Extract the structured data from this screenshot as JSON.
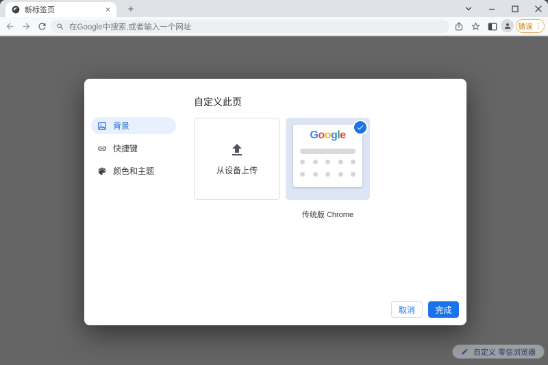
{
  "colors": {
    "accent_blue": "#1a73e8",
    "active_item_bg": "#e7f0fd",
    "active_item_text": "#1967d2",
    "error_orange": "#cc7a00",
    "overlay_gray": "#656565",
    "card_selected_bg": "#dde5f5"
  },
  "window": {
    "tab": {
      "title": "新标签页",
      "close_icon": "×"
    },
    "new_tab_button": "+"
  },
  "toolbar": {
    "omnibox": {
      "placeholder": "在Google中搜索,或者输入一个网址"
    },
    "error_badge": {
      "label": "错误",
      "menu_dots": "⋮"
    }
  },
  "dialog": {
    "title": "自定义此页",
    "sidebar": {
      "items": [
        {
          "id": "background",
          "label": "背景",
          "icon": "image-icon",
          "active": true
        },
        {
          "id": "shortcuts",
          "label": "快捷键",
          "icon": "link-icon",
          "active": false
        },
        {
          "id": "colors-theme",
          "label": "颜色和主题",
          "icon": "palette-icon",
          "active": false
        }
      ]
    },
    "upload_card": {
      "label": "从设备上传",
      "icon": "upload-icon"
    },
    "theme_card": {
      "label": "传统版 Chrome",
      "selected": true,
      "logo_letters": [
        {
          "ch": "G",
          "color": "#4285F4"
        },
        {
          "ch": "o",
          "color": "#EA4335"
        },
        {
          "ch": "o",
          "color": "#FBBC05"
        },
        {
          "ch": "g",
          "color": "#4285F4"
        },
        {
          "ch": "l",
          "color": "#34A853"
        },
        {
          "ch": "e",
          "color": "#EA4335"
        }
      ],
      "dot_rows": 2,
      "dot_cols": 5
    },
    "footer": {
      "cancel": "取消",
      "done": "完成"
    }
  },
  "page": {
    "customize_pill": {
      "label": "自定义 零信浏览器",
      "icon": "pencil-icon"
    }
  }
}
